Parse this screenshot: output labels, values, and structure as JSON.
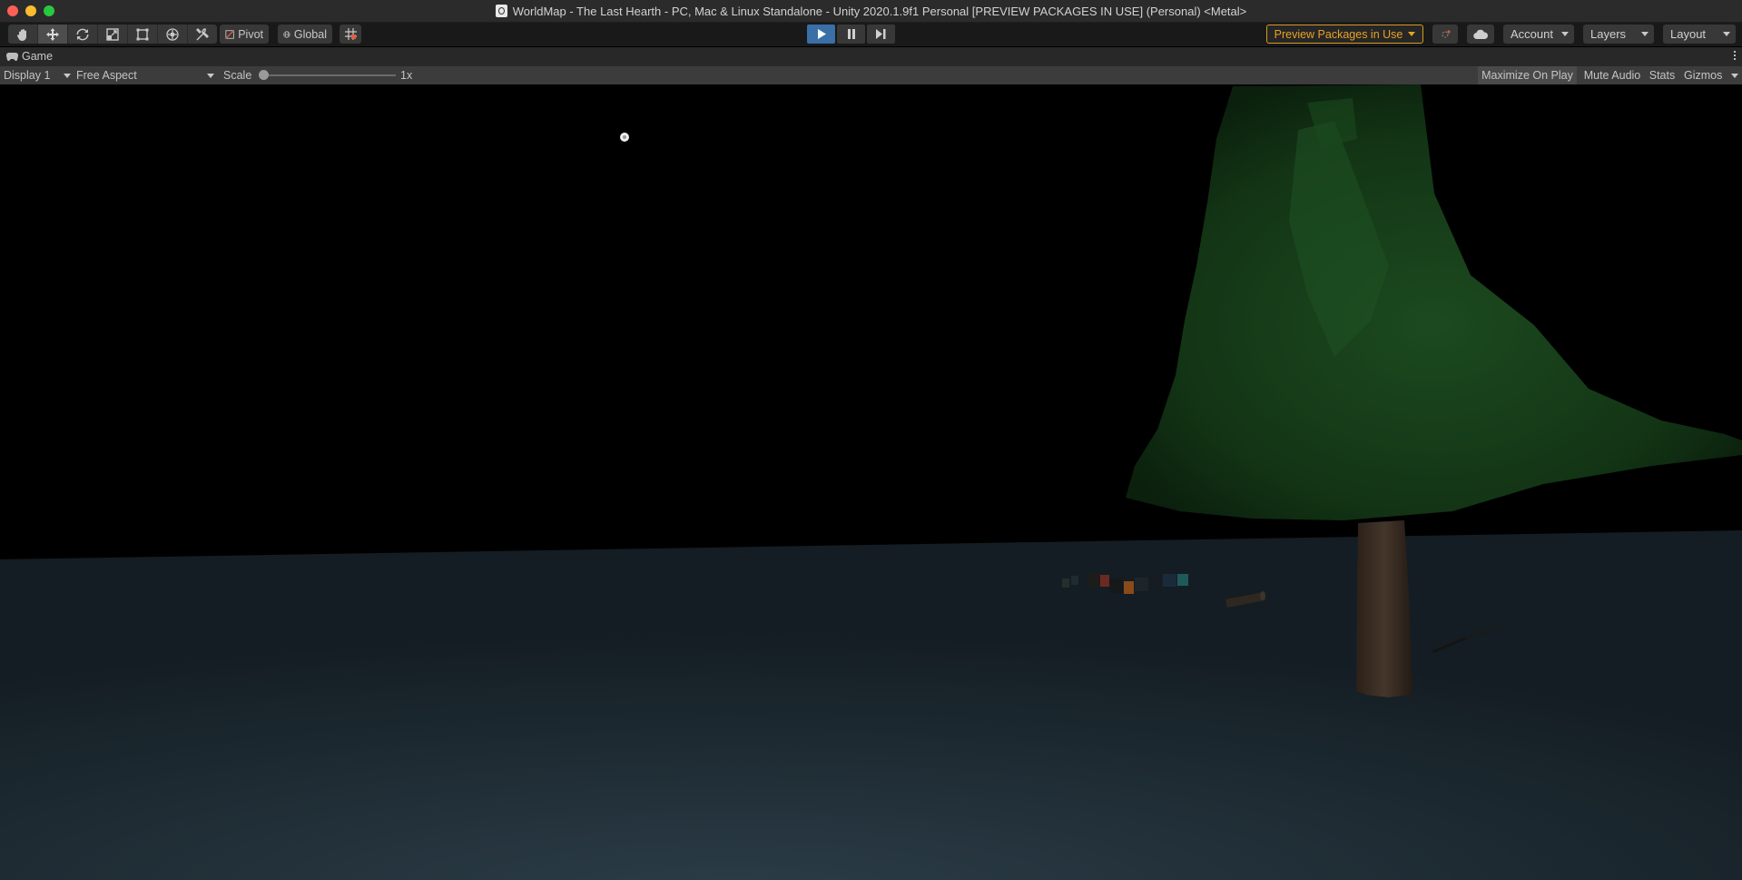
{
  "window": {
    "title": "WorldMap - The Last Hearth - PC, Mac & Linux Standalone - Unity 2020.1.9f1 Personal [PREVIEW PACKAGES IN USE] (Personal) <Metal>",
    "traffic_colors": [
      "#fe5f57",
      "#febc2e",
      "#28c840"
    ]
  },
  "toolbar": {
    "tools": [
      "hand-tool-icon",
      "move-tool-icon",
      "rotate-tool-icon",
      "scale-tool-icon",
      "rect-tool-icon",
      "transform-tool-icon",
      "custom-tool-icon"
    ],
    "pivot_label": "Pivot",
    "global_label": "Global",
    "preview_packages_label": "Preview Packages in Use",
    "account_label": "Account",
    "layers_label": "Layers",
    "layout_label": "Layout",
    "accent_play": "#3a6fa8",
    "accent_preview": "#e7a323"
  },
  "game_tab": {
    "label": "Game"
  },
  "game_bar": {
    "display_label": "Display 1",
    "aspect_label": "Free Aspect",
    "scale_label": "Scale",
    "scale_value": "1x",
    "scale_fraction": 0.0,
    "maximize_label": "Maximize On Play",
    "mute_label": "Mute Audio",
    "stats_label": "Stats",
    "gizmos_label": "Gizmos"
  },
  "scene": {
    "sky_color": "#000000",
    "ground_color": "#1f2c34",
    "tree_color": "#143a17",
    "trunk_color": "#3a2e24"
  }
}
